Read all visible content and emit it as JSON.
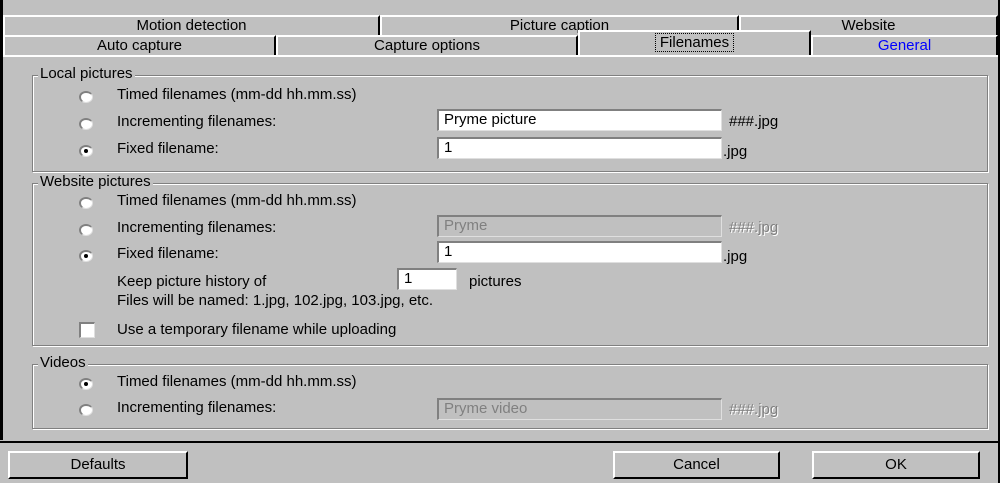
{
  "tabs_row1": [
    {
      "label": "Motion detection"
    },
    {
      "label": "Picture caption"
    },
    {
      "label": "Website"
    }
  ],
  "tabs_row2": [
    {
      "label": "Auto capture"
    },
    {
      "label": "Capture options"
    },
    {
      "label": "Filenames",
      "active": true
    },
    {
      "label": "General",
      "highlight": "#0000ff"
    }
  ],
  "local": {
    "title": "Local pictures",
    "opt_timed": "Timed filenames (mm-dd  hh.mm.ss)",
    "opt_incrementing": "Incrementing filenames:",
    "incrementing_value": "Pryme picture",
    "incrementing_suffix": "###.jpg",
    "opt_fixed": "Fixed filename:",
    "fixed_value": "1",
    "fixed_suffix": ".jpg",
    "selected": "fixed"
  },
  "website": {
    "title": "Website pictures",
    "opt_timed": "Timed filenames (mm-dd  hh.mm.ss)",
    "opt_incrementing": "Incrementing filenames:",
    "incrementing_value": "Pryme",
    "incrementing_suffix": "###.jpg",
    "opt_fixed": "Fixed filename:",
    "fixed_value": "1",
    "fixed_suffix": ".jpg",
    "selected": "fixed",
    "history_prefix": "Keep picture history of",
    "history_value": "1",
    "history_suffix": "pictures",
    "files_note": "Files will be named: 1.jpg, 102.jpg, 103.jpg, etc.",
    "temp_label": "Use a temporary filename while uploading",
    "temp_checked": false
  },
  "videos": {
    "title": "Videos",
    "opt_timed": "Timed filenames (mm-dd  hh.mm.ss)",
    "opt_incrementing": "Incrementing filenames:",
    "incrementing_value": "Pryme video",
    "incrementing_suffix": "###.jpg",
    "selected": "timed"
  },
  "buttons": {
    "defaults": "Defaults",
    "cancel": "Cancel",
    "ok": "OK"
  }
}
